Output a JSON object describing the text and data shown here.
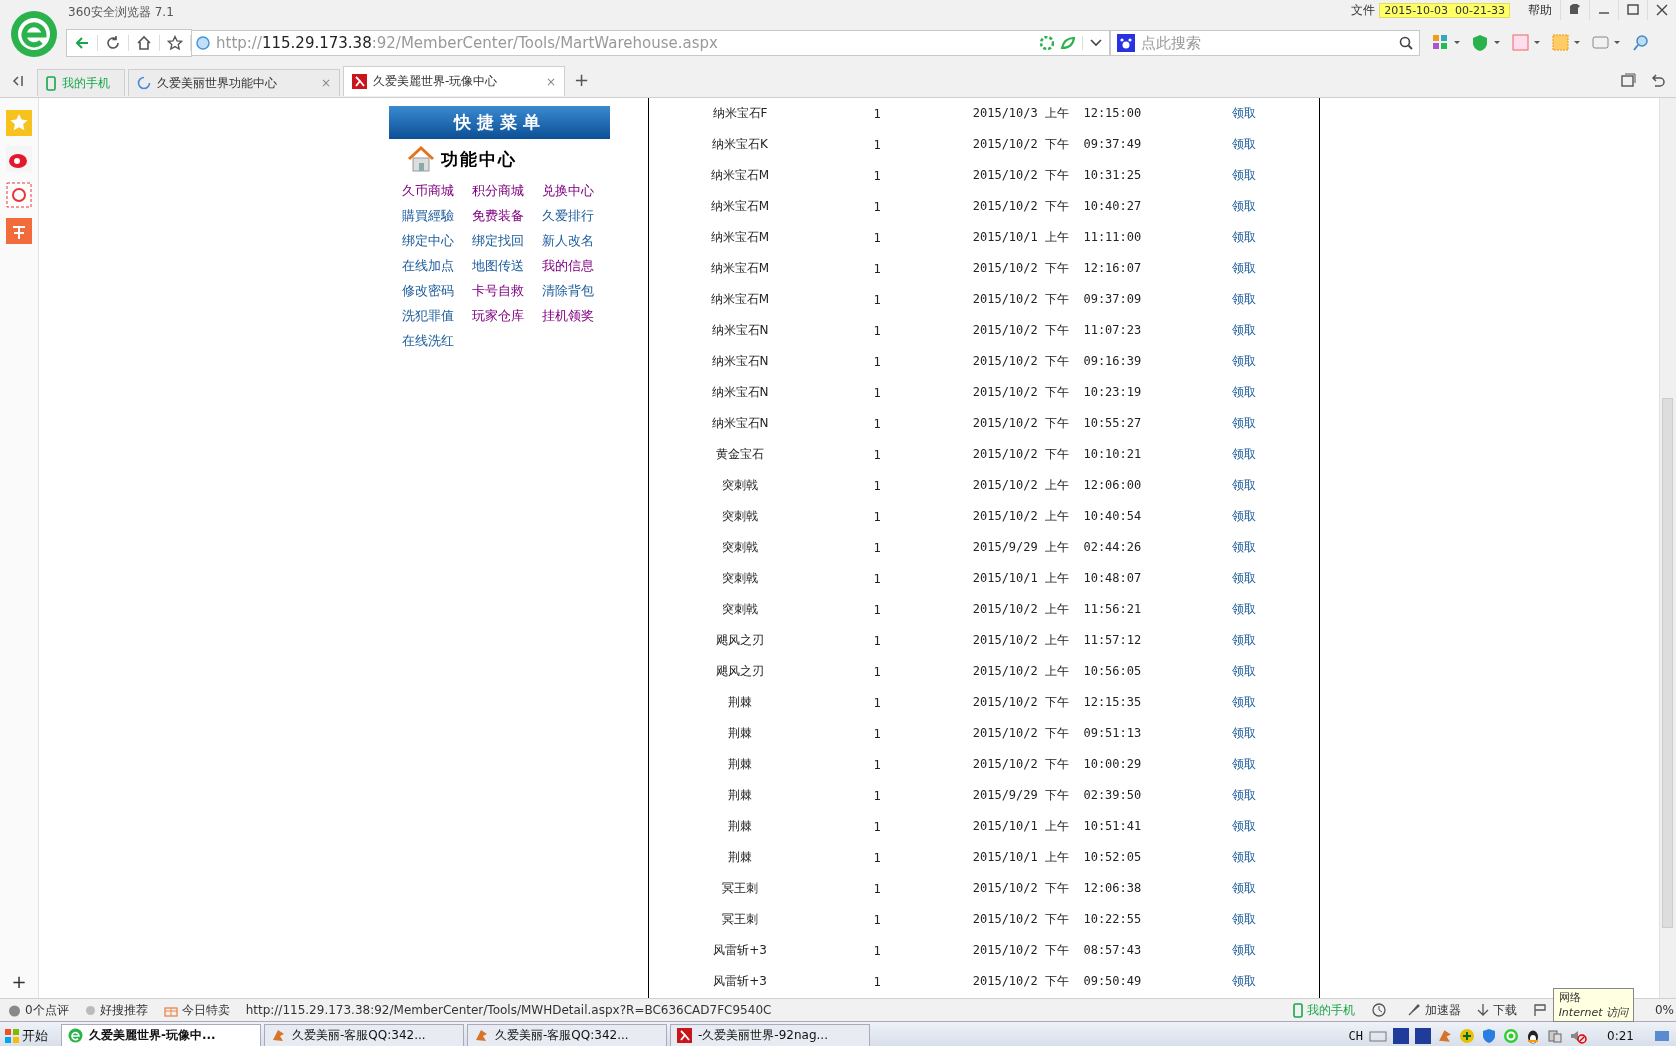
{
  "window": {
    "title": "360安全浏览器 7.1",
    "menu": [
      "文件",
      "帮助"
    ],
    "clock_tooltip": "2015-10-03  00-21-33"
  },
  "address_bar": {
    "scheme": "http://",
    "host": "115.29.173.38",
    "path": ":92/MemberCenter/Tools/MartWarehouse.aspx"
  },
  "search": {
    "placeholder": "点此搜索"
  },
  "tab_close_glyph": "×",
  "new_tab_glyph": "+",
  "sidebar_add_glyph": "+",
  "tabs": [
    {
      "kind": "phone",
      "label": "我的手机",
      "selected": false
    },
    {
      "kind": "loading",
      "label": "久爱美丽世界功能中心",
      "selected": false
    },
    {
      "kind": "site",
      "label": "久爱美麗世界-玩像中心",
      "selected": true
    }
  ],
  "quick_menu": {
    "title": "快捷菜单",
    "heading": "功能中心",
    "links": [
      {
        "label": "久币商城",
        "visited": true
      },
      {
        "label": "积分商城",
        "visited": true
      },
      {
        "label": "兑换中心",
        "visited": true
      },
      {
        "label": "購買經驗",
        "visited": false
      },
      {
        "label": "免费装备",
        "visited": true
      },
      {
        "label": "久爱排行",
        "visited": false
      },
      {
        "label": "绑定中心",
        "visited": false
      },
      {
        "label": "绑定找回",
        "visited": false
      },
      {
        "label": "新人改名",
        "visited": false
      },
      {
        "label": "在线加点",
        "visited": false
      },
      {
        "label": "地图传送",
        "visited": false
      },
      {
        "label": "我的信息",
        "visited": true
      },
      {
        "label": "修改密码",
        "visited": false
      },
      {
        "label": "卡号自救",
        "visited": true
      },
      {
        "label": "清除背包",
        "visited": false
      },
      {
        "label": "洗犯罪值",
        "visited": false
      },
      {
        "label": "玩家仓库",
        "visited": true
      },
      {
        "label": "挂机领奖",
        "visited": true
      },
      {
        "label": "在线洗红",
        "visited": false
      }
    ]
  },
  "table": {
    "rows": [
      [
        "纳米宝石F",
        "1",
        "2015/10/3 上午  12:15:00",
        "领取"
      ],
      [
        "纳米宝石K",
        "1",
        "2015/10/2 下午  09:37:49",
        "领取"
      ],
      [
        "纳米宝石M",
        "1",
        "2015/10/2 下午  10:31:25",
        "领取"
      ],
      [
        "纳米宝石M",
        "1",
        "2015/10/2 下午  10:40:27",
        "领取"
      ],
      [
        "纳米宝石M",
        "1",
        "2015/10/1 上午  11:11:00",
        "领取"
      ],
      [
        "纳米宝石M",
        "1",
        "2015/10/2 下午  12:16:07",
        "领取"
      ],
      [
        "纳米宝石M",
        "1",
        "2015/10/2 下午  09:37:09",
        "领取"
      ],
      [
        "纳米宝石N",
        "1",
        "2015/10/2 下午  11:07:23",
        "领取"
      ],
      [
        "纳米宝石N",
        "1",
        "2015/10/2 下午  09:16:39",
        "领取"
      ],
      [
        "纳米宝石N",
        "1",
        "2015/10/2 下午  10:23:19",
        "领取"
      ],
      [
        "纳米宝石N",
        "1",
        "2015/10/2 下午  10:55:27",
        "领取"
      ],
      [
        "黄金宝石",
        "1",
        "2015/10/2 下午  10:10:21",
        "领取"
      ],
      [
        "突刺戟",
        "1",
        "2015/10/2 上午  12:06:00",
        "领取"
      ],
      [
        "突刺戟",
        "1",
        "2015/10/2 上午  10:40:54",
        "领取"
      ],
      [
        "突刺戟",
        "1",
        "2015/9/29 上午  02:44:26",
        "领取"
      ],
      [
        "突刺戟",
        "1",
        "2015/10/1 上午  10:48:07",
        "领取"
      ],
      [
        "突刺戟",
        "1",
        "2015/10/2 上午  11:56:21",
        "领取"
      ],
      [
        "飓风之刃",
        "1",
        "2015/10/2 上午  11:57:12",
        "领取"
      ],
      [
        "飓风之刃",
        "1",
        "2015/10/2 上午  10:56:05",
        "领取"
      ],
      [
        "荆棘",
        "1",
        "2015/10/2 下午  12:15:35",
        "领取"
      ],
      [
        "荆棘",
        "1",
        "2015/10/2 下午  09:51:13",
        "领取"
      ],
      [
        "荆棘",
        "1",
        "2015/10/2 下午  10:00:29",
        "领取"
      ],
      [
        "荆棘",
        "1",
        "2015/9/29 下午  02:39:50",
        "领取"
      ],
      [
        "荆棘",
        "1",
        "2015/10/1 上午  10:51:41",
        "领取"
      ],
      [
        "荆棘",
        "1",
        "2015/10/1 上午  10:52:05",
        "领取"
      ],
      [
        "冥王刺",
        "1",
        "2015/10/2 下午  12:06:38",
        "领取"
      ],
      [
        "冥王刺",
        "1",
        "2015/10/2 下午  10:22:55",
        "领取"
      ],
      [
        "风雷斩+3",
        "1",
        "2015/10/2 下午  08:57:43",
        "领取"
      ],
      [
        "风雷斩+3",
        "1",
        "2015/10/2 下午  09:50:49",
        "领取"
      ]
    ]
  },
  "status_bar": {
    "reviews": "0个点评",
    "recommend": "好搜推荐",
    "deals": "今日特卖",
    "link_url": "http://115.29.173.38:92/MemberCenter/Tools/MWHDetail.aspx?R=BC636CAD7FC9540C",
    "phone": "我的手机",
    "accelerator": "加速器",
    "download": "下载",
    "tooltip_title": "网络",
    "tooltip_text": "Internet 访问",
    "zoom": "0%"
  },
  "taskbar": {
    "start": "开始",
    "tasks": [
      {
        "kind": "browser",
        "label": "久爱美麗世界-玩像中...",
        "selected": true
      },
      {
        "kind": "chat",
        "label": "久爱美丽-客服QQ:342...",
        "selected": false
      },
      {
        "kind": "chat",
        "label": "久爱美丽-客服QQ:342...",
        "selected": false
      },
      {
        "kind": "site",
        "label": "-久爱美丽世界-92nag...",
        "selected": false
      }
    ],
    "lang": "CH",
    "time": "0:21"
  }
}
